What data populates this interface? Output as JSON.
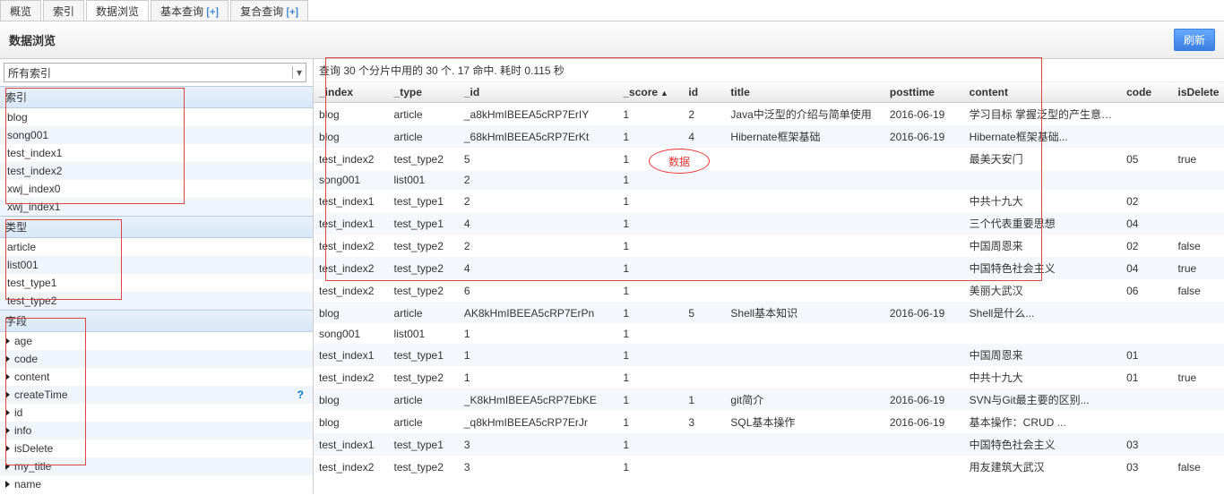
{
  "tabs": {
    "overview": "概览",
    "index": "索引",
    "browse": "数据浏览",
    "basic": "基本查询",
    "complex": "复合查询",
    "plus": "[+]"
  },
  "titlebar": {
    "title": "数据浏览",
    "refresh": "刷新"
  },
  "dropdown": {
    "label": "所有索引"
  },
  "sections": {
    "index": "索引",
    "type": "类型",
    "field": "字段"
  },
  "indexList": [
    "blog",
    "song001",
    "test_index1",
    "test_index2",
    "xwj_index0",
    "xwj_index1"
  ],
  "typeList": [
    "article",
    "list001",
    "test_type1",
    "test_type2"
  ],
  "fieldList": [
    "age",
    "code",
    "content",
    "createTime",
    "id",
    "info",
    "isDelete",
    "my_title",
    "name"
  ],
  "fieldQ": {
    "createTime": "?"
  },
  "summary": "查询 30 个分片中用的 30 个. 17 命中. 耗时 0.115 秒",
  "columns": {
    "_index": "_index",
    "_type": "_type",
    "_id": "_id",
    "_score": "_score",
    "id": "id",
    "title": "title",
    "posttime": "posttime",
    "content": "content",
    "code": "code",
    "isDelete": "isDelete"
  },
  "sortIndicator": "▲",
  "rows": [
    {
      "_index": "blog",
      "_type": "article",
      "_id": "_a8kHmIBEEA5cRP7ErIY",
      "_score": "1",
      "id": "2",
      "title": "Java中泛型的介绍与简单使用",
      "posttime": "2016-06-19",
      "content": "学习目标 掌握泛型的产生意义...",
      "code": "",
      "isDelete": ""
    },
    {
      "_index": "blog",
      "_type": "article",
      "_id": "_68kHmIBEEA5cRP7ErKt",
      "_score": "1",
      "id": "4",
      "title": "Hibernate框架基础",
      "posttime": "2016-06-19",
      "content": "Hibernate框架基础...",
      "code": "",
      "isDelete": ""
    },
    {
      "_index": "test_index2",
      "_type": "test_type2",
      "_id": "5",
      "_score": "1",
      "id": "",
      "title": "",
      "posttime": "",
      "content": "最美天安门",
      "code": "05",
      "isDelete": "true"
    },
    {
      "_index": "song001",
      "_type": "list001",
      "_id": "2",
      "_score": "1",
      "id": "",
      "title": "",
      "posttime": "",
      "content": "",
      "code": "",
      "isDelete": ""
    },
    {
      "_index": "test_index1",
      "_type": "test_type1",
      "_id": "2",
      "_score": "1",
      "id": "",
      "title": "",
      "posttime": "",
      "content": "中共十九大",
      "code": "02",
      "isDelete": ""
    },
    {
      "_index": "test_index1",
      "_type": "test_type1",
      "_id": "4",
      "_score": "1",
      "id": "",
      "title": "",
      "posttime": "",
      "content": "三个代表重要思想",
      "code": "04",
      "isDelete": ""
    },
    {
      "_index": "test_index2",
      "_type": "test_type2",
      "_id": "2",
      "_score": "1",
      "id": "",
      "title": "",
      "posttime": "",
      "content": "中国周恩来",
      "code": "02",
      "isDelete": "false"
    },
    {
      "_index": "test_index2",
      "_type": "test_type2",
      "_id": "4",
      "_score": "1",
      "id": "",
      "title": "",
      "posttime": "",
      "content": "中国特色社会主义",
      "code": "04",
      "isDelete": "true"
    },
    {
      "_index": "test_index2",
      "_type": "test_type2",
      "_id": "6",
      "_score": "1",
      "id": "",
      "title": "",
      "posttime": "",
      "content": "美丽大武汉",
      "code": "06",
      "isDelete": "false"
    },
    {
      "_index": "blog",
      "_type": "article",
      "_id": "AK8kHmIBEEA5cRP7ErPn",
      "_score": "1",
      "id": "5",
      "title": "Shell基本知识",
      "posttime": "2016-06-19",
      "content": "Shell是什么...",
      "code": "",
      "isDelete": ""
    },
    {
      "_index": "song001",
      "_type": "list001",
      "_id": "1",
      "_score": "1",
      "id": "",
      "title": "",
      "posttime": "",
      "content": "",
      "code": "",
      "isDelete": ""
    },
    {
      "_index": "test_index1",
      "_type": "test_type1",
      "_id": "1",
      "_score": "1",
      "id": "",
      "title": "",
      "posttime": "",
      "content": "中国周恩来",
      "code": "01",
      "isDelete": ""
    },
    {
      "_index": "test_index2",
      "_type": "test_type2",
      "_id": "1",
      "_score": "1",
      "id": "",
      "title": "",
      "posttime": "",
      "content": "中共十九大",
      "code": "01",
      "isDelete": "true"
    },
    {
      "_index": "blog",
      "_type": "article",
      "_id": "_K8kHmIBEEA5cRP7EbKE",
      "_score": "1",
      "id": "1",
      "title": "git简介",
      "posttime": "2016-06-19",
      "content": "SVN与Git最主要的区别...",
      "code": "",
      "isDelete": ""
    },
    {
      "_index": "blog",
      "_type": "article",
      "_id": "_q8kHmIBEEA5cRP7ErJr",
      "_score": "1",
      "id": "3",
      "title": "SQL基本操作",
      "posttime": "2016-06-19",
      "content": "基本操作：CRUD ...",
      "code": "",
      "isDelete": ""
    },
    {
      "_index": "test_index1",
      "_type": "test_type1",
      "_id": "3",
      "_score": "1",
      "id": "",
      "title": "",
      "posttime": "",
      "content": "中国特色社会主义",
      "code": "03",
      "isDelete": ""
    },
    {
      "_index": "test_index2",
      "_type": "test_type2",
      "_id": "3",
      "_score": "1",
      "id": "",
      "title": "",
      "posttime": "",
      "content": "用友建筑大武汉",
      "code": "03",
      "isDelete": "false"
    }
  ],
  "annot": {
    "data": "数据"
  }
}
